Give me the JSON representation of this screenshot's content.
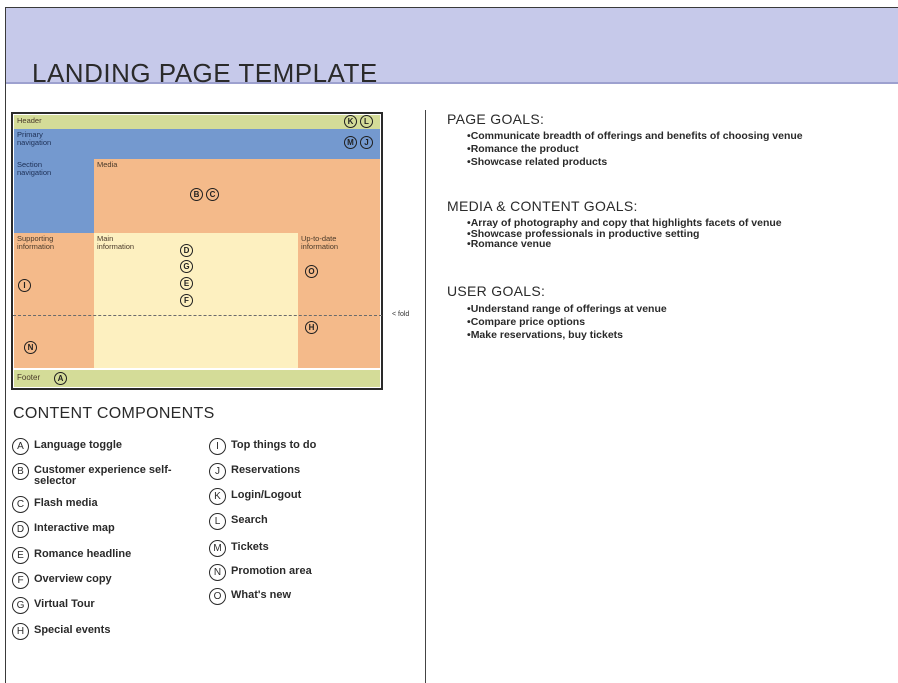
{
  "title": "LANDING PAGE TEMPLATE",
  "wireframe": {
    "header": "Header",
    "primary_nav": "Primary navigation",
    "section_nav": "Section navigation",
    "media": "Media",
    "supporting": "Supporting information",
    "main": "Main information",
    "uptodate": "Up-to-date information",
    "footer": "Footer",
    "fold_label": "< fold",
    "markers": {
      "header": [
        "K",
        "L"
      ],
      "nav": [
        "M",
        "J"
      ],
      "media": [
        "B",
        "C"
      ],
      "main": [
        "D",
        "G",
        "E",
        "F"
      ],
      "supporting_top": "I",
      "supporting_bottom": "N",
      "uptodate_top": "O",
      "uptodate_bottom": "H",
      "footer": "A"
    }
  },
  "content_components": {
    "heading": "CONTENT COMPONENTS",
    "left": [
      {
        "letter": "A",
        "label": "Language toggle"
      },
      {
        "letter": "B",
        "label": "Customer experience self-selector"
      },
      {
        "letter": "C",
        "label": "Flash media"
      },
      {
        "letter": "D",
        "label": "Interactive map"
      },
      {
        "letter": "E",
        "label": "Romance headline"
      },
      {
        "letter": "F",
        "label": "Overview copy"
      },
      {
        "letter": "G",
        "label": "Virtual Tour"
      },
      {
        "letter": "H",
        "label": "Special events"
      }
    ],
    "right": [
      {
        "letter": "I",
        "label": "Top things to do"
      },
      {
        "letter": "J",
        "label": "Reservations"
      },
      {
        "letter": "K",
        "label": "Login/Logout"
      },
      {
        "letter": "L",
        "label": "Search"
      },
      {
        "letter": "M",
        "label": "Tickets"
      },
      {
        "letter": "N",
        "label": "Promotion area"
      },
      {
        "letter": "O",
        "label": "What's new"
      }
    ]
  },
  "goals": {
    "page": {
      "heading": "PAGE GOALS:",
      "items": [
        "Communicate breadth of offerings and benefits of choosing venue",
        "Romance the product",
        "Showcase related products"
      ]
    },
    "media": {
      "heading": "MEDIA & CONTENT GOALS:",
      "items": [
        "Array of photography and copy that highlights facets of venue",
        "Showcase professionals in productive setting",
        "Romance venue"
      ]
    },
    "user": {
      "heading": "USER GOALS:",
      "items": [
        "Understand range of offerings at venue",
        "Compare price options",
        "Make reservations, buy tickets"
      ]
    }
  }
}
